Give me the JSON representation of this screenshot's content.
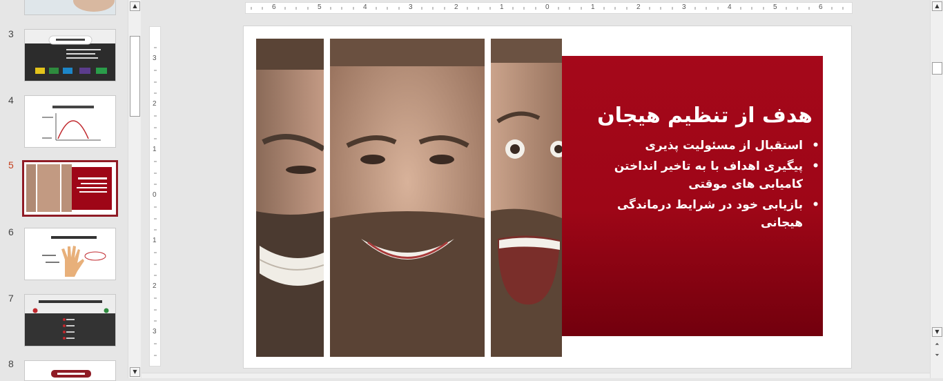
{
  "thumbnails": [
    {
      "number": "3",
      "title": "تعریف تنظیم هیجان"
    },
    {
      "number": "4",
      "title": "تعریف تنظیم هیجان"
    },
    {
      "number": "5",
      "title": "هدف از تنظیم هیجان"
    },
    {
      "number": "6",
      "title": "باورهای مانع از تنظیم هیجان"
    },
    {
      "number": "7",
      "title": "اولین باور مانع: خوب و بد بودن هیجان ها"
    },
    {
      "number": "8",
      "title": "هر هیجانی پیامی دارد"
    }
  ],
  "selected_slide": "5",
  "ruler": {
    "horizontal": [
      "6",
      "5",
      "4",
      "3",
      "2",
      "1",
      "0",
      "1",
      "2",
      "3",
      "4",
      "5",
      "6"
    ],
    "vertical": [
      "3",
      "2",
      "1",
      "0",
      "1",
      "2",
      "3"
    ]
  },
  "slide": {
    "title": "هدف از تنظیم هیجان",
    "bullets": [
      "استقبال از مسئولیت پذیری",
      "پیگیری اهداف با به تاخیر انداختن کامیابی های موقتی",
      "بازیابی خود در شرایط درماندگی هیجانی"
    ]
  },
  "colors": {
    "accent": "#9e0617",
    "selection_border": "#8f1b25",
    "active_number": "#c43e1c"
  }
}
